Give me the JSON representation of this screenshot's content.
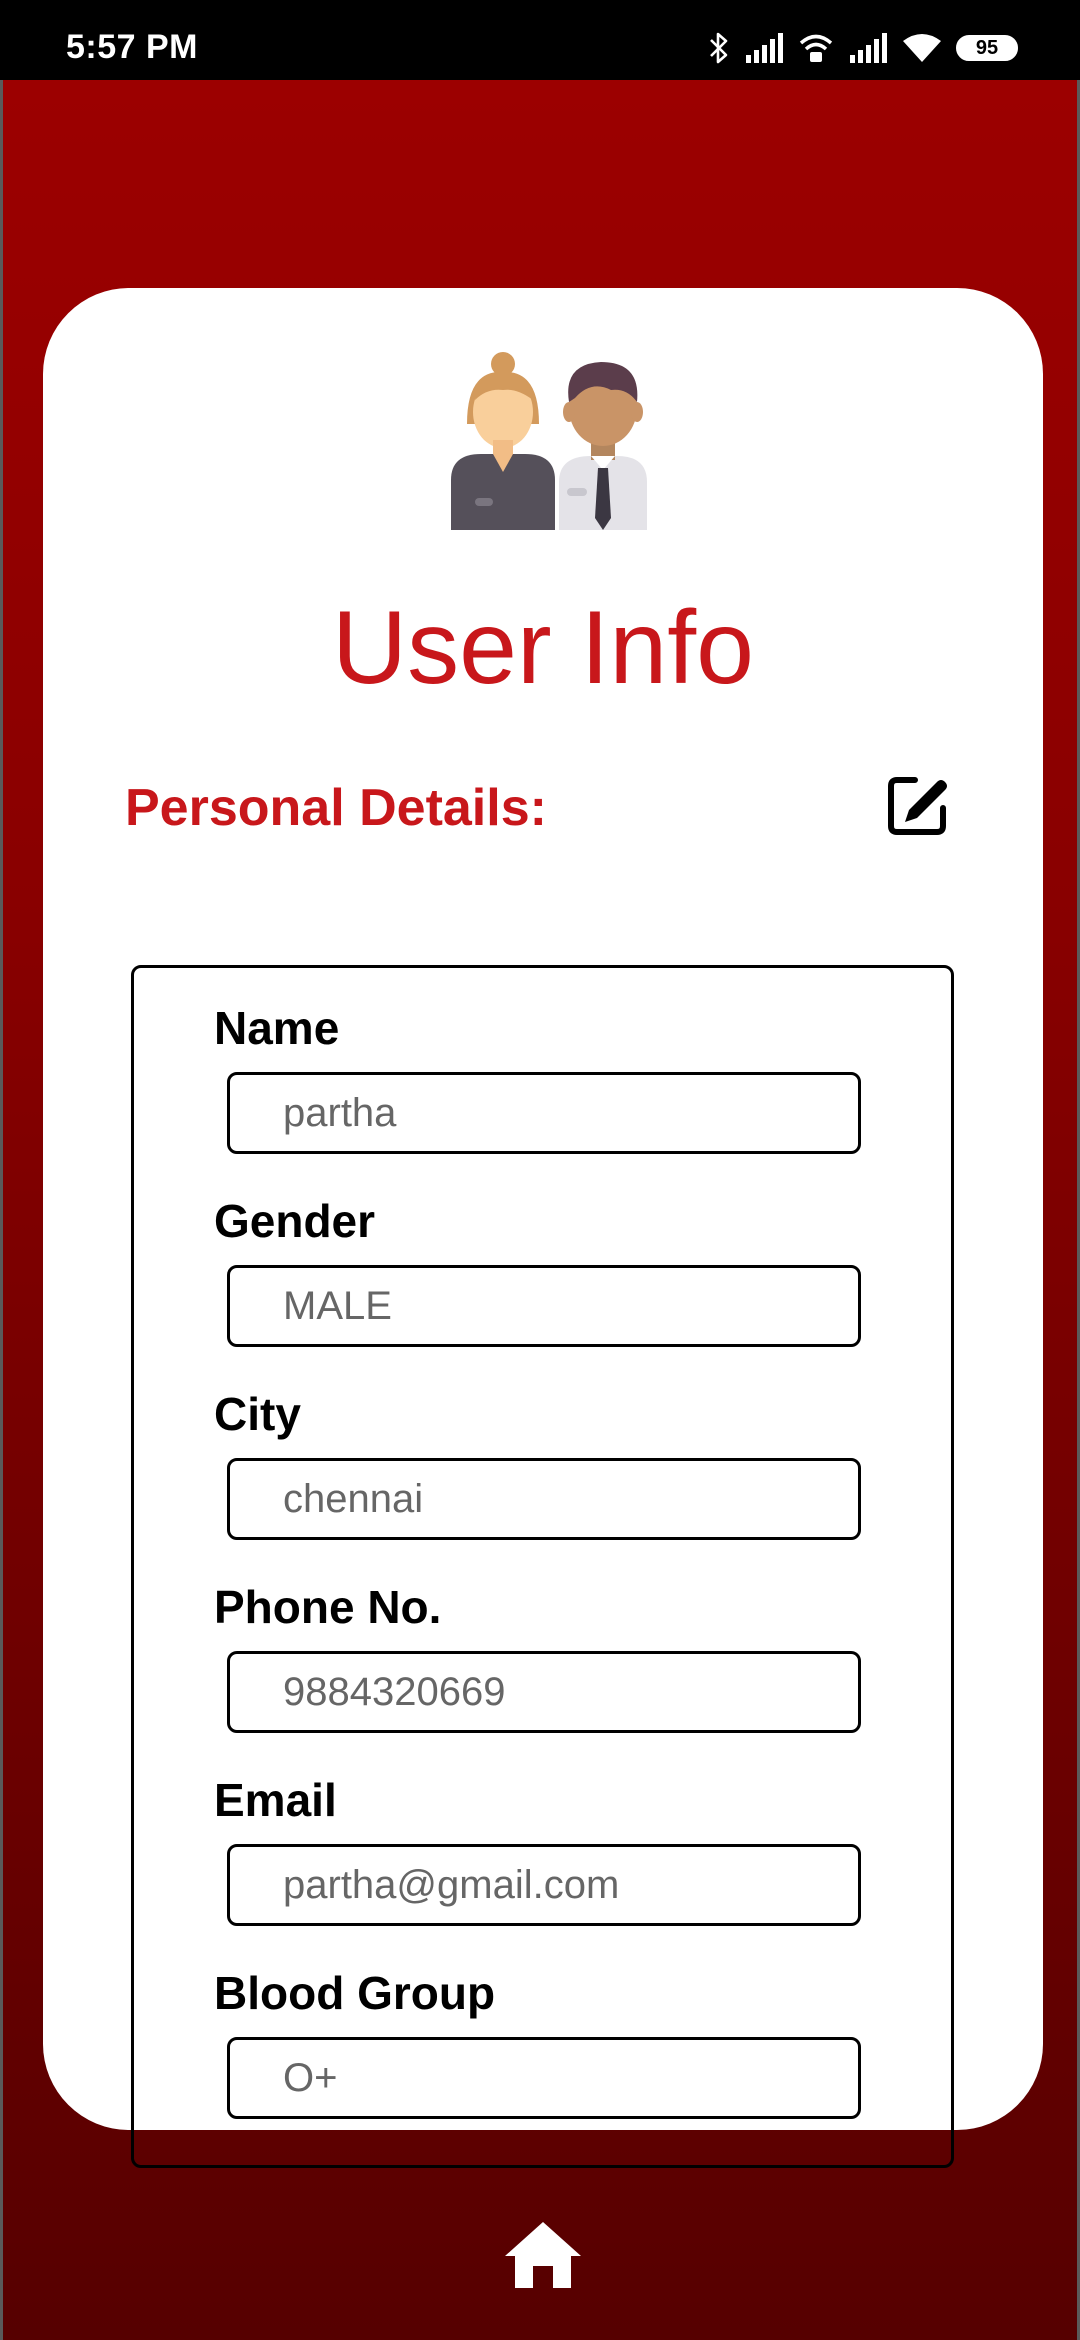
{
  "status_bar": {
    "time": "5:57 PM",
    "battery": "95",
    "icons": [
      "bluetooth-icon",
      "signal-icon",
      "wifi-calling-icon",
      "signal-icon",
      "wifi-icon",
      "battery-icon"
    ]
  },
  "colors": {
    "accent": "#c8171b",
    "background_top": "#9c0000",
    "background_bottom": "#560000"
  },
  "header": {
    "title": "User Info",
    "avatar_icon": "users-icon"
  },
  "section": {
    "title": "Personal Details:",
    "edit_icon": "edit-icon"
  },
  "fields": [
    {
      "label": "Name",
      "value": "partha"
    },
    {
      "label": "Gender",
      "value": "MALE"
    },
    {
      "label": "City",
      "value": "chennai"
    },
    {
      "label": "Phone No.",
      "value": "9884320669"
    },
    {
      "label": "Email",
      "value": "partha@gmail.com"
    },
    {
      "label": "Blood Group",
      "value": "O+"
    }
  ],
  "nav": {
    "home_icon": "home-icon"
  }
}
